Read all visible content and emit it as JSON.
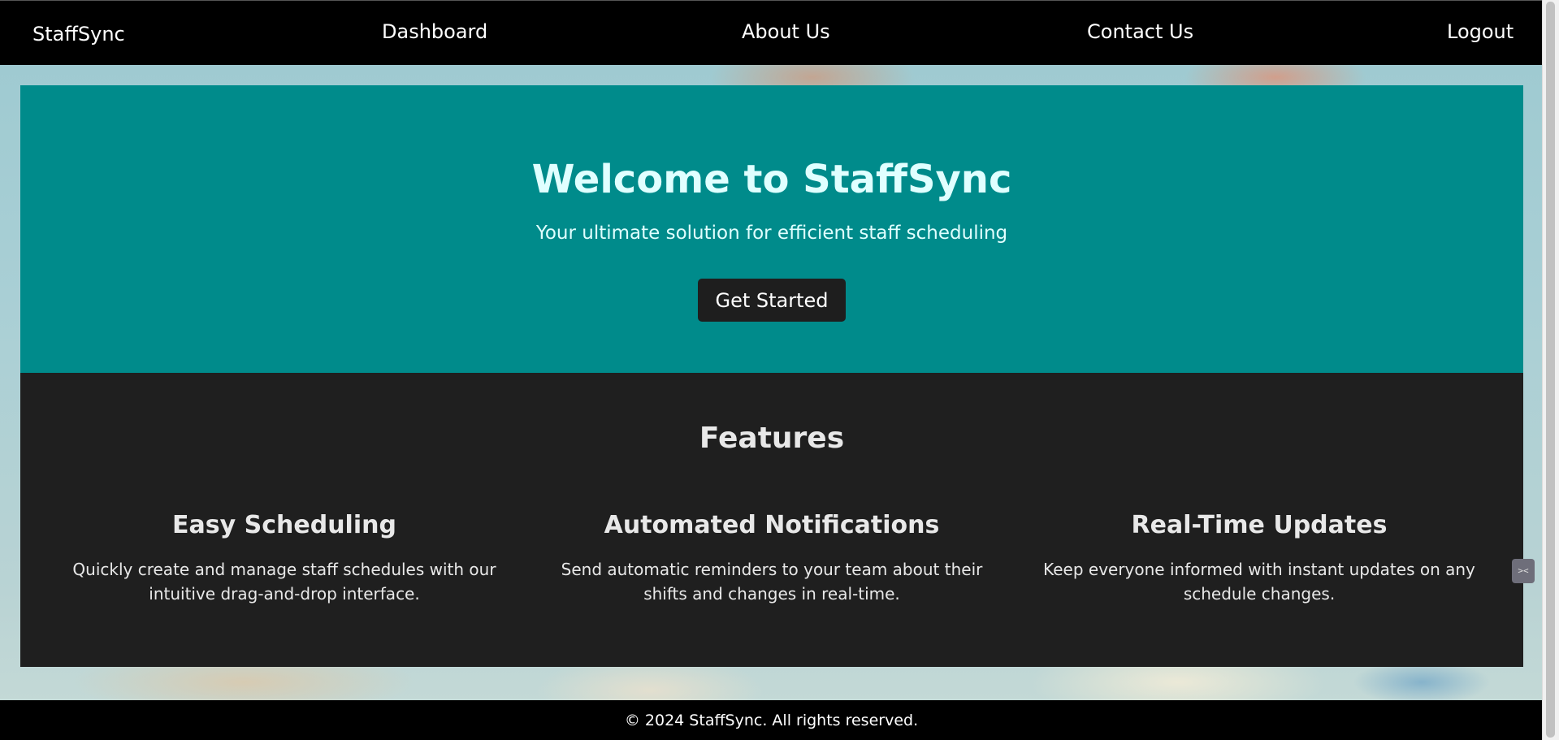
{
  "header": {
    "brand": "StaffSync",
    "nav": {
      "dashboard": "Dashboard",
      "about": "About Us",
      "contact": "Contact Us",
      "logout": "Logout"
    }
  },
  "hero": {
    "title": "Welcome to StaffSync",
    "subtitle": "Your ultimate solution for efficient staff scheduling",
    "cta_label": "Get Started"
  },
  "features": {
    "heading": "Features",
    "items": [
      {
        "title": "Easy Scheduling",
        "description": "Quickly create and manage staff schedules with our intuitive drag-and-drop interface."
      },
      {
        "title": "Automated Notifications",
        "description": "Send automatic reminders to your team about their shifts and changes in real-time."
      },
      {
        "title": "Real-Time Updates",
        "description": "Keep everyone informed with instant updates on any schedule changes."
      }
    ]
  },
  "footer": {
    "copyright": "© 2024 StaffSync. All rights reserved."
  },
  "icons": {
    "side_widget": "code-icon"
  },
  "colors": {
    "header_bg": "#000000",
    "hero_bg": "#008b8b",
    "hero_text": "#e0ffff",
    "features_bg": "#1f1f1f",
    "button_bg": "#1e1e1e"
  }
}
